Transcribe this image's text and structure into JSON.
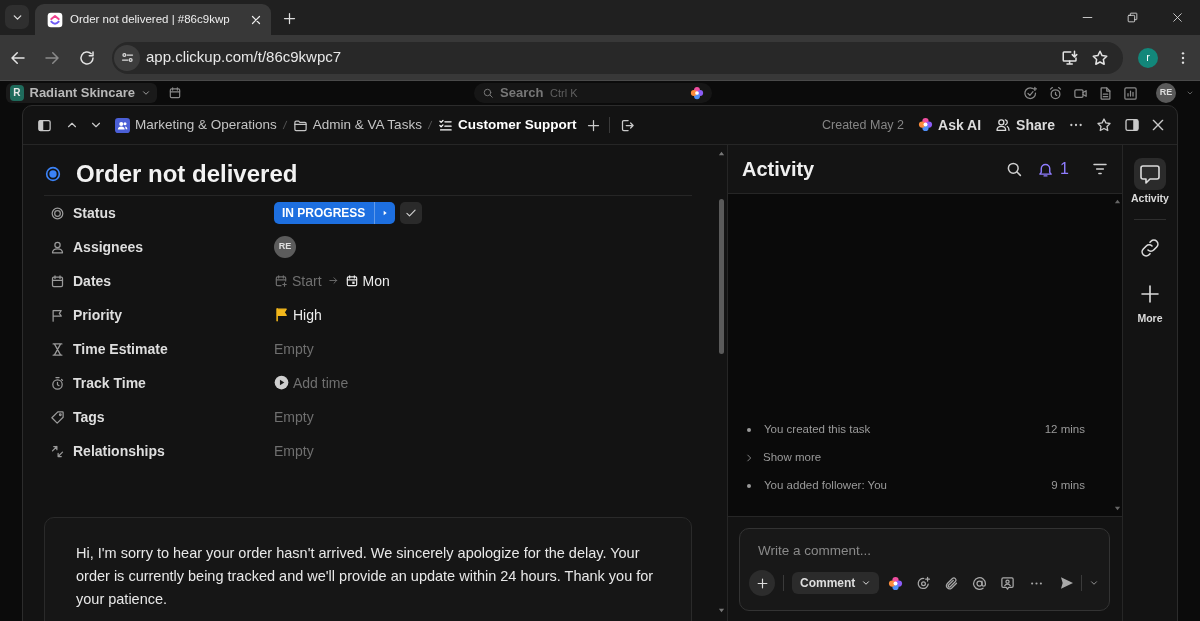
{
  "browser": {
    "tab_title": "Order not delivered | #86c9kwp",
    "url": "app.clickup.com/t/86c9kwpc7",
    "profile_initial": "r"
  },
  "app_bar": {
    "workspace_initial": "R",
    "workspace": "Radiant Skincare",
    "search_placeholder": "Search",
    "search_shortcut": "Ctrl K",
    "user_initials": "RE"
  },
  "task": {
    "breadcrumb": [
      {
        "kind": "space",
        "label": "Marketing & Operations",
        "current": false
      },
      {
        "kind": "folder",
        "label": "Admin & VA Tasks",
        "current": false
      },
      {
        "kind": "list",
        "label": "Customer Support",
        "current": true
      }
    ],
    "created": "Created May 2",
    "ask_ai": "Ask AI",
    "share": "Share",
    "title": "Order not delivered",
    "fields": [
      {
        "kind": "status",
        "label": "Status",
        "value": "IN PROGRESS"
      },
      {
        "kind": "assignees",
        "label": "Assignees",
        "value": "RE"
      },
      {
        "kind": "dates",
        "label": "Dates",
        "start": "Start",
        "due": "Mon"
      },
      {
        "kind": "priority",
        "label": "Priority",
        "value": "High"
      },
      {
        "kind": "estimate",
        "label": "Time Estimate",
        "value": "Empty"
      },
      {
        "kind": "tracking",
        "label": "Track Time",
        "value": "Add time"
      },
      {
        "kind": "tags",
        "label": "Tags",
        "value": "Empty"
      },
      {
        "kind": "relationships",
        "label": "Relationships",
        "value": "Empty"
      }
    ],
    "description": "Hi, I'm sorry to hear your order hasn't arrived. We sincerely apologize for the delay. Your order is currently being tracked and we'll provide an update within 24 hours. Thank you for your patience."
  },
  "activity": {
    "title": "Activity",
    "notifications": "1",
    "items": [
      {
        "kind": "event",
        "text": "You created this task",
        "time": "12 mins"
      },
      {
        "kind": "toggle",
        "text": "Show more"
      },
      {
        "kind": "event",
        "text": "You added follower: You",
        "time": "9 mins"
      }
    ],
    "comment_placeholder": "Write a comment...",
    "comment_mode": "Comment"
  },
  "rail": [
    {
      "kind": "activity",
      "label": "Activity",
      "selected": true
    },
    {
      "kind": "links",
      "selected": false
    },
    {
      "kind": "more",
      "label": "More",
      "selected": false
    }
  ]
}
